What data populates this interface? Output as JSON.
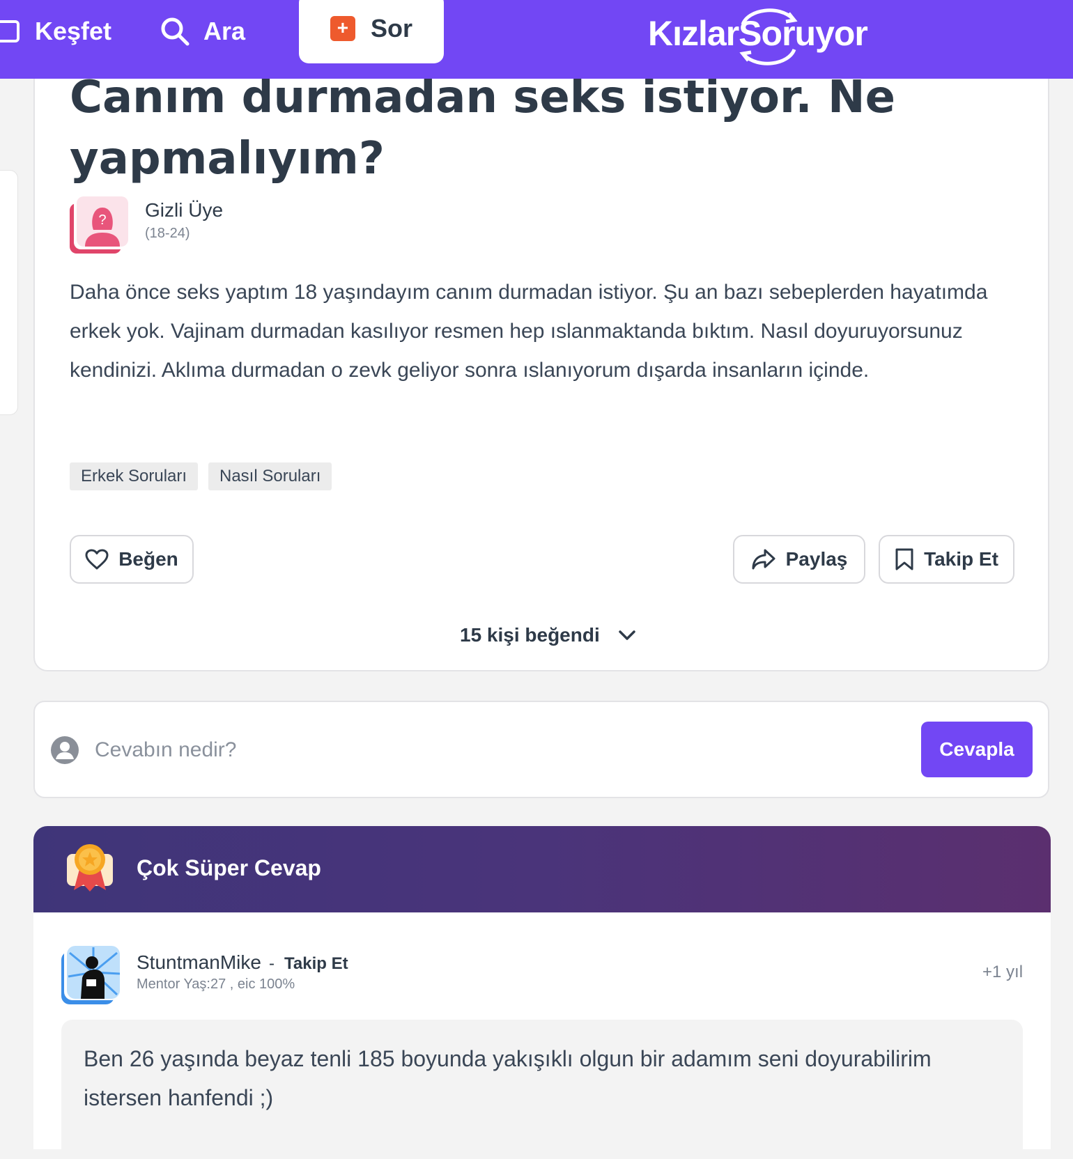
{
  "nav": {
    "kesfet_label": "Keşfet",
    "ara_label": "Ara",
    "sor_label": "Sor",
    "logo_text_1": "Kızlar",
    "logo_text_2": "Soruyor",
    "brand_color": "#7247f4"
  },
  "question": {
    "title": "Canım durmadan seks istiyor. Ne yapmalıyım?",
    "author_name": "Gizli Üye",
    "author_age": "(18-24)",
    "body": "Daha önce seks yaptım 18 yaşındayım canım durmadan istiyor. Şu an bazı sebeplerden hayatımda erkek yok. Vajinam durmadan kasılıyor resmen hep ıslanmaktanda bıktım. Nasıl doyuruyorsunuz kendinizi. Aklıma durmadan o zevk geliyor sonra ıslanıyorum dışarda insanların içinde.",
    "tags": [
      "Erkek Soruları",
      "Nasıl Soruları"
    ],
    "like_label": "Beğen",
    "share_label": "Paylaş",
    "follow_label": "Takip Et",
    "likes_text": "15 kişi beğendi"
  },
  "answer_input": {
    "placeholder": "Cevabın nedir?",
    "submit_label": "Cevapla"
  },
  "super_answer": {
    "header_title": "Çok Süper Cevap",
    "user": "StuntmanMike",
    "dash": "-",
    "follow_label": "Takip Et",
    "meta": "Mentor Yaş:27 , eic 100%",
    "time": "+1 yıl",
    "text": "Ben 26 yaşında beyaz tenli 185 boyunda yakışıklı olgun bir adamım seni doyurabilirim istersen hanfendi ;)"
  }
}
